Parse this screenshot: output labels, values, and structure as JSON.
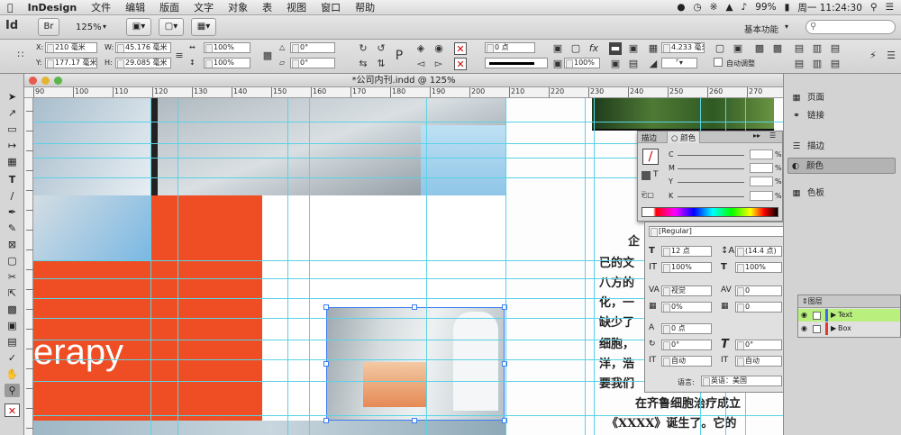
{
  "menubar": {
    "app": "InDesign",
    "items": [
      "文件",
      "编辑",
      "版面",
      "文字",
      "对象",
      "表",
      "视图",
      "窗口",
      "帮助"
    ],
    "battery": "99%",
    "clock": "周一 11:24:30"
  },
  "appbar": {
    "logo": "Id",
    "bridge": "Br",
    "zoom": "125%",
    "workspace": "基本功能",
    "search_placeholder": ""
  },
  "control": {
    "x_label": "X:",
    "x_value": "210 毫米",
    "y_label": "Y:",
    "y_value": "177.17 毫米",
    "w_label": "W:",
    "w_value": "45.176 毫米",
    "h_label": "H:",
    "h_value": "29.085 毫米",
    "scale_x": "100%",
    "scale_y": "100%",
    "rotate": "0°",
    "shear": "0°",
    "stroke_weight": "0 点",
    "opacity": "100%",
    "fit_value": "4.233 毫米",
    "auto_fit": "自动调整"
  },
  "document": {
    "title": "*公司内刊.indd @ 125%",
    "ruler_ticks": [
      "90",
      "100",
      "110",
      "120",
      "130",
      "140",
      "150",
      "160",
      "170",
      "180",
      "190",
      "200",
      "210",
      "220",
      "230",
      "240",
      "250",
      "260",
      "270"
    ],
    "big_text": "erapy",
    "chinese_lines": [
      "企",
      "已的文",
      "八方的",
      "化，一",
      "缺少了",
      "细胞，",
      "洋，浩",
      "要我们",
      "在齐鲁细胞治疗成立",
      "《XXXX》诞生了。它的"
    ]
  },
  "color_panel": {
    "tab_stroke": "描边",
    "tab_color": "颜色",
    "channels": [
      "C",
      "M",
      "Y",
      "K"
    ],
    "percent": "%"
  },
  "char_panel": {
    "font_style": "[Regular]",
    "size": "12 点",
    "leading": "(14.4 点)",
    "scale_v": "100%",
    "scale_h": "100%",
    "kerning": "视觉",
    "tracking": "0",
    "tsume": "0%",
    "space": "0",
    "baseline": "0 点",
    "skew": "0°",
    "rotation": "0°",
    "auto1": "自动",
    "auto2": "自动",
    "lang_label": "语言:",
    "lang": "英语：美国"
  },
  "panels": {
    "items": [
      "页面",
      "链接",
      "描边",
      "颜色",
      "色板"
    ]
  },
  "layers": {
    "title": "图层",
    "rows": [
      "Text",
      "Box"
    ]
  },
  "colors": {
    "orange": "#ef4d23",
    "guide": "#5ad2e6",
    "selected": "#3b7df0"
  }
}
